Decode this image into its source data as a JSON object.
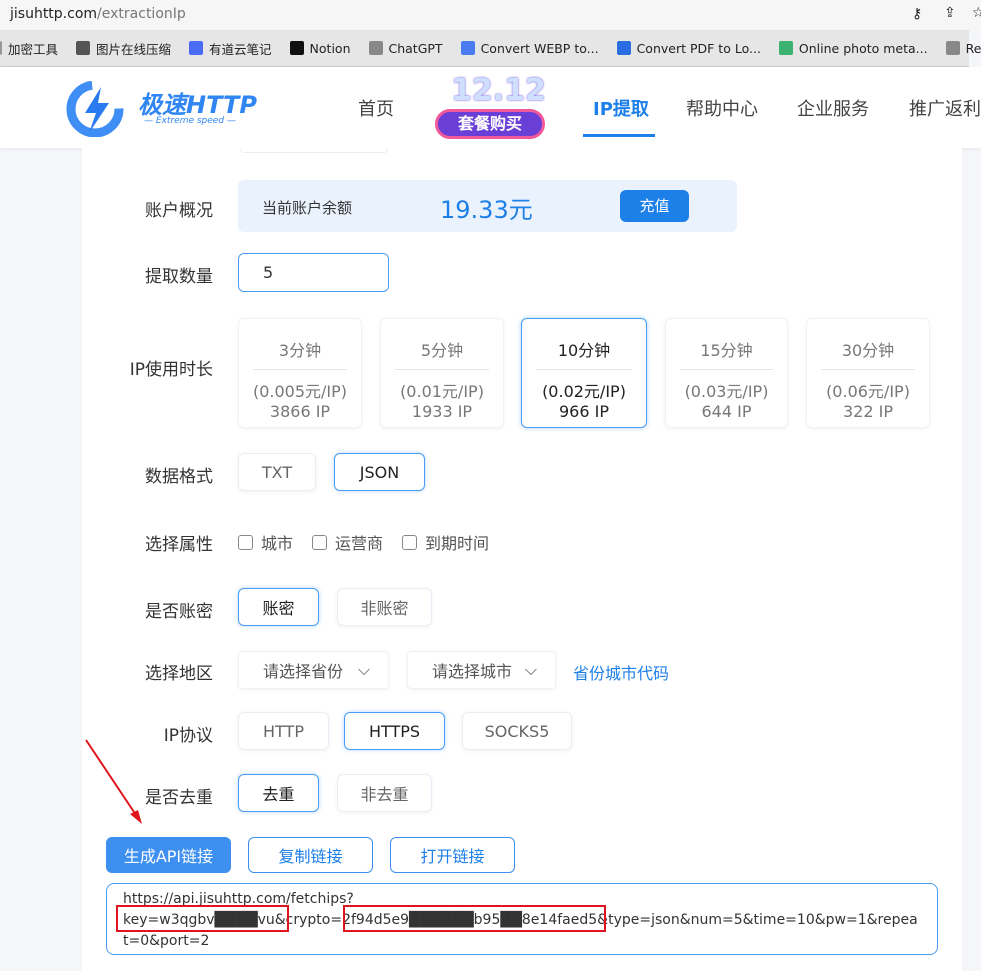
{
  "browser": {
    "url_host": "jisuhttp.com",
    "url_path": "/extractionIp",
    "bookmarks": [
      {
        "label": "加密工具",
        "color": "#999"
      },
      {
        "label": "图片在线压缩",
        "color": "#555"
      },
      {
        "label": "有道云笔记",
        "color": "#4a6cf7"
      },
      {
        "label": "Notion",
        "color": "#111"
      },
      {
        "label": "ChatGPT",
        "color": "#888"
      },
      {
        "label": "Convert WEBP to...",
        "color": "#4a7cf0"
      },
      {
        "label": "Convert PDF to Lo...",
        "color": "#2b6de0"
      },
      {
        "label": "Online photo meta...",
        "color": "#3cb371"
      },
      {
        "label": "Relakkes",
        "color": "#888"
      }
    ]
  },
  "header": {
    "logo_text": "极速HTTP",
    "logo_sub": "Extreme speed",
    "promo_top": "12.12",
    "promo_bottom": "套餐购买",
    "nav": [
      "首页",
      "IP提取",
      "帮助中心",
      "企业服务",
      "推广返利"
    ],
    "active_nav": "IP提取"
  },
  "form": {
    "account": {
      "label": "账户概况",
      "balance_label": "当前账户余额",
      "balance": "19.33元",
      "recharge": "充值"
    },
    "quantity": {
      "label": "提取数量",
      "value": "5"
    },
    "duration": {
      "label": "IP使用时长",
      "options": [
        {
          "time": "3分钟",
          "price": "(0.005元/IP)",
          "count": "3866 IP"
        },
        {
          "time": "5分钟",
          "price": "(0.01元/IP)",
          "count": "1933 IP"
        },
        {
          "time": "10分钟",
          "price": "(0.02元/IP)",
          "count": "966 IP"
        },
        {
          "time": "15分钟",
          "price": "(0.03元/IP)",
          "count": "644 IP"
        },
        {
          "time": "30分钟",
          "price": "(0.06元/IP)",
          "count": "322 IP"
        }
      ],
      "selected": "10分钟"
    },
    "format": {
      "label": "数据格式",
      "options": [
        "TXT",
        "JSON"
      ],
      "selected": "JSON"
    },
    "attributes": {
      "label": "选择属性",
      "options": [
        "城市",
        "运营商",
        "到期时间"
      ]
    },
    "auth": {
      "label": "是否账密",
      "options": [
        "账密",
        "非账密"
      ],
      "selected": "账密"
    },
    "region": {
      "label": "选择地区",
      "province_placeholder": "请选择省份",
      "city_placeholder": "请选择城市",
      "code_link": "省份城市代码"
    },
    "protocol": {
      "label": "IP协议",
      "options": [
        "HTTP",
        "HTTPS",
        "SOCKS5"
      ],
      "selected": "HTTPS"
    },
    "dedupe": {
      "label": "是否去重",
      "options": [
        "去重",
        "非去重"
      ],
      "selected": "去重"
    }
  },
  "actions": {
    "generate": "生成API链接",
    "copy": "复制链接",
    "open": "打开链接"
  },
  "api_link": {
    "line1": "https://api.jisuhttp.com/fetchips?",
    "key": "key=w3qgbv████vu",
    "mid1": "&crypto=",
    "crypto": "2f94d5e9██████b95██8e14faed5",
    "rest": "&type=json&num=5&time=10&pw=1&repeat=0&port=2"
  },
  "colors": {
    "accent": "#1d7fe8",
    "annotation": "#e0141e"
  }
}
